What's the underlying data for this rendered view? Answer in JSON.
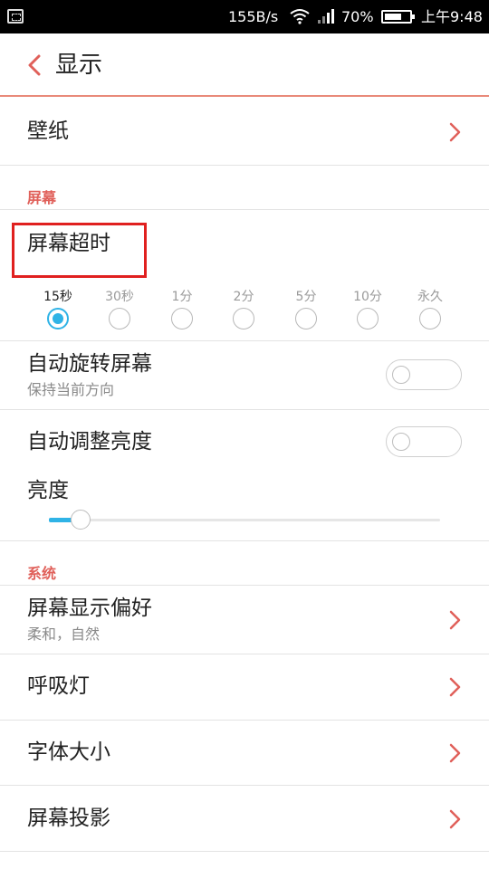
{
  "status_bar": {
    "speed": "155B/s",
    "battery_percent": "70%",
    "battery_level": 0.7,
    "time": "上午9:48"
  },
  "header": {
    "title": "显示"
  },
  "wallpaper": {
    "label": "壁纸"
  },
  "sections": {
    "screen": "屏幕",
    "system": "系统"
  },
  "screen_timeout": {
    "label": "屏幕超时",
    "options": [
      "15秒",
      "30秒",
      "1分",
      "2分",
      "5分",
      "10分",
      "永久"
    ],
    "selected_index": 0
  },
  "auto_rotate": {
    "label": "自动旋转屏幕",
    "sub": "保持当前方向",
    "enabled": false
  },
  "auto_brightness": {
    "label": "自动调整亮度",
    "enabled": false
  },
  "brightness": {
    "label": "亮度",
    "level": 0.08
  },
  "system_items": [
    {
      "label": "屏幕显示偏好",
      "sub": "柔和，自然"
    },
    {
      "label": "呼吸灯"
    },
    {
      "label": "字体大小"
    },
    {
      "label": "屏幕投影"
    }
  ],
  "colors": {
    "accent": "#e0605a",
    "highlight_box": "#e0201f",
    "selected_blue": "#2fb3e6"
  }
}
